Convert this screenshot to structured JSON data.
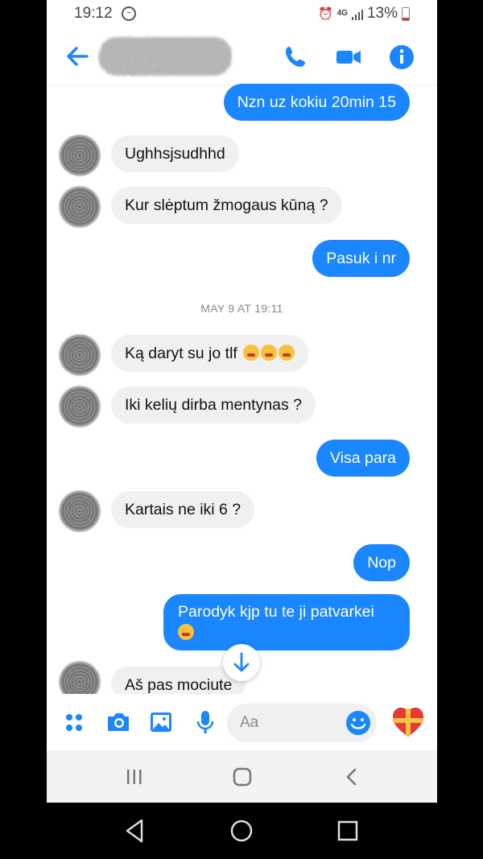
{
  "status_bar": {
    "time": "19:12",
    "network": "4G",
    "battery": "13%"
  },
  "header": {
    "contact_name_visible": ""
  },
  "messages": [
    {
      "id": "m1",
      "direction": "outgoing",
      "text": "Nzn uz kokiu 20min 15"
    },
    {
      "id": "m2",
      "direction": "incoming",
      "text": "Ughhsjsudhhd"
    },
    {
      "id": "m3",
      "direction": "incoming",
      "text": "Kur slėptum žmogaus kūną ?"
    },
    {
      "id": "m4",
      "direction": "outgoing",
      "text": "Pasuk i nr"
    },
    {
      "id": "m5",
      "direction": "incoming",
      "text": "Ką daryt su jo tlf"
    },
    {
      "id": "m6",
      "direction": "incoming",
      "text": "Iki kelių dirba mentynas ?"
    },
    {
      "id": "m7",
      "direction": "outgoing",
      "text": "Visa para"
    },
    {
      "id": "m8",
      "direction": "incoming",
      "text": "Kartais ne iki 6 ?"
    },
    {
      "id": "m9",
      "direction": "outgoing",
      "text": "Nop"
    },
    {
      "id": "m10",
      "direction": "outgoing",
      "text": "Parodyk kjp tu te ji patvarkei"
    },
    {
      "id": "m11",
      "direction": "incoming",
      "text": "Aš pas mociute"
    }
  ],
  "timestamp": "MAY 9 AT 19:11",
  "composer": {
    "placeholder": "Aa"
  },
  "colors": {
    "accent": "#1a86ff",
    "incoming_bubble": "#f0f0f0"
  },
  "icons": [
    "back-arrow-icon",
    "phone-icon",
    "video-camera-icon",
    "info-icon",
    "scroll-down-arrow-icon",
    "menu-dots-icon",
    "camera-icon",
    "gallery-icon",
    "microphone-icon",
    "smiley-icon",
    "heart-gift-icon"
  ]
}
